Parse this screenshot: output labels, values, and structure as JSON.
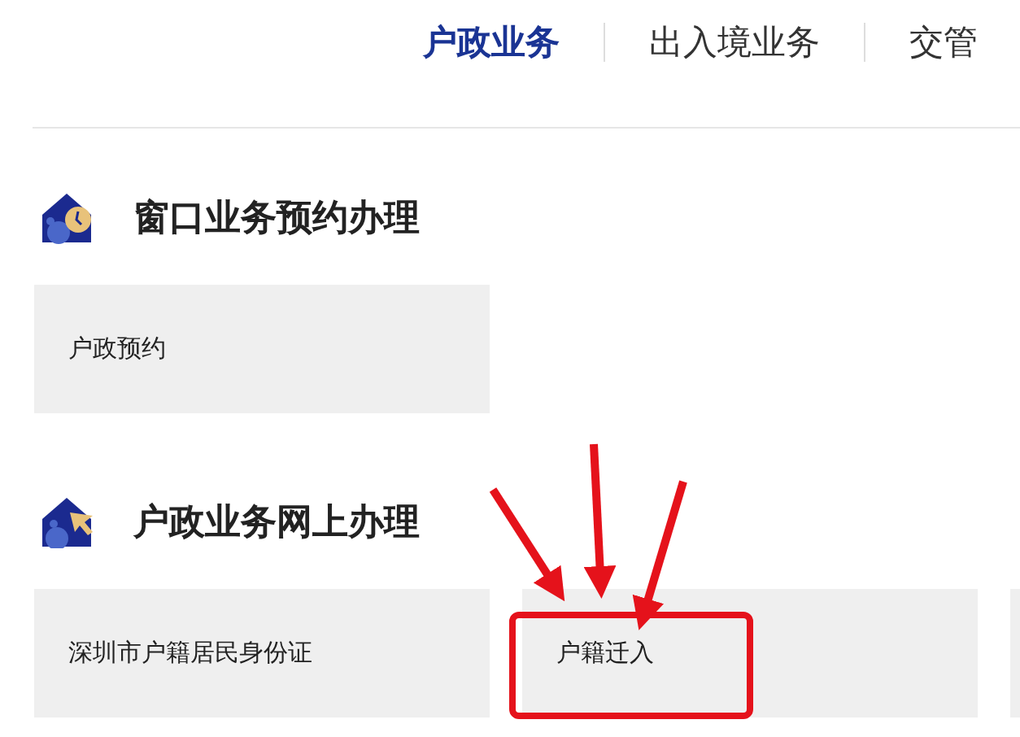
{
  "nav": {
    "tabs": [
      {
        "label": "户政业务",
        "selected": true
      },
      {
        "label": "出入境业务",
        "selected": false
      },
      {
        "label": "交管",
        "selected": false
      }
    ]
  },
  "sections": [
    {
      "title": "窗口业务预约办理",
      "cards": [
        {
          "label": "户政预约",
          "highlighted": false
        }
      ]
    },
    {
      "title": "户政业务网上办理",
      "cards": [
        {
          "label": "深圳市户籍居民身份证",
          "highlighted": false
        },
        {
          "label": "户籍迁入",
          "highlighted": true
        }
      ],
      "more_cards": true
    }
  ]
}
